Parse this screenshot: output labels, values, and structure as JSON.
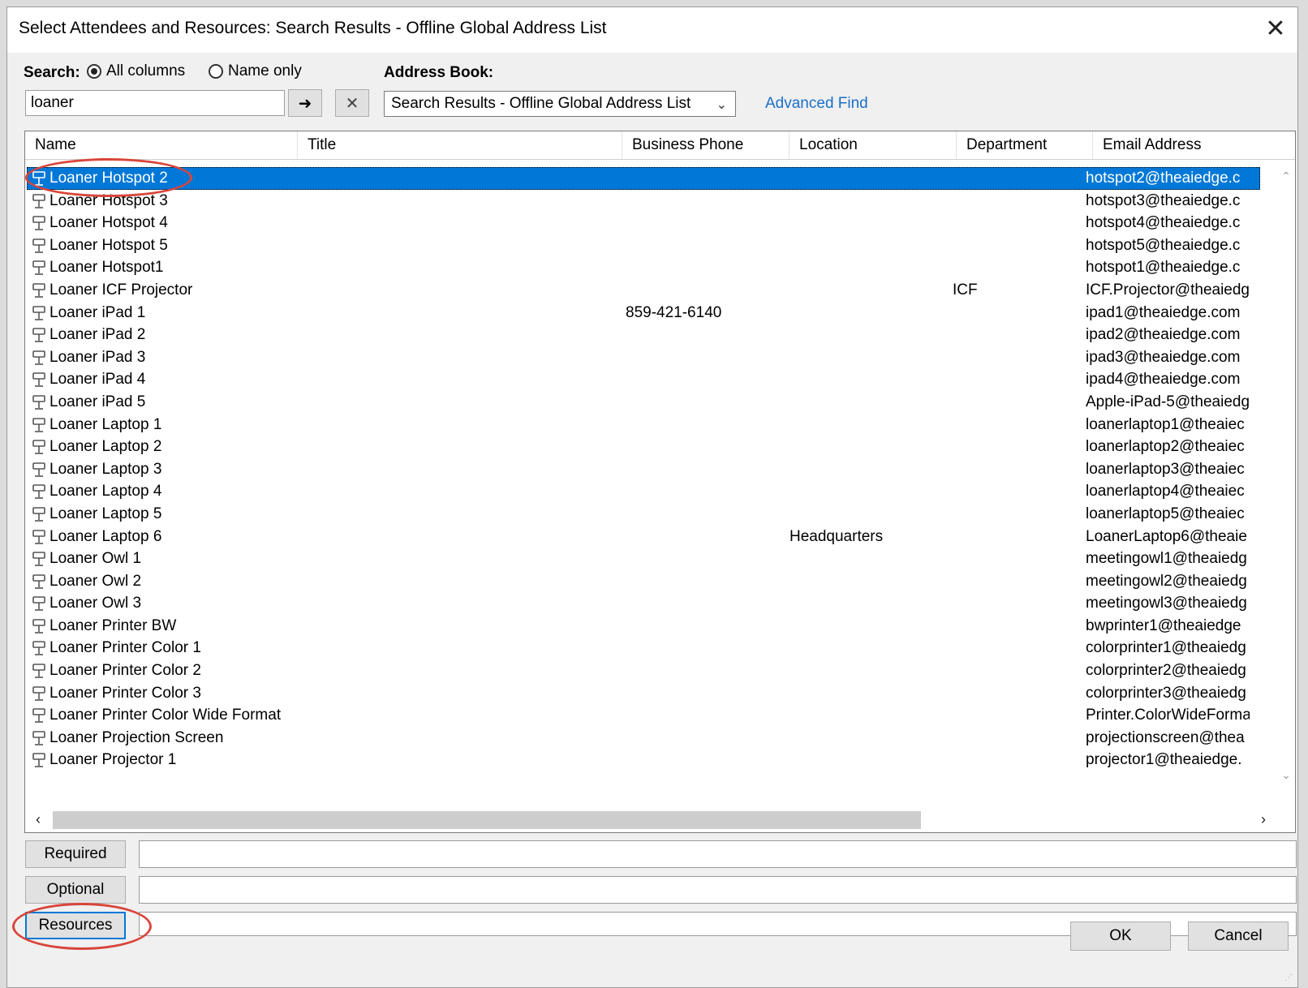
{
  "window": {
    "title": "Select Attendees and Resources: Search Results - Offline Global Address List"
  },
  "search": {
    "label": "Search:",
    "options": [
      "All columns",
      "Name only"
    ],
    "selected_option": "All columns",
    "value": "loaner",
    "go_symbol": "➜",
    "clear_symbol": "✕"
  },
  "address_book": {
    "label": "Address Book:",
    "selected": "Search Results - Offline Global Address List"
  },
  "advanced_find": "Advanced Find",
  "columns": [
    "Name",
    "Title",
    "Business Phone",
    "Location",
    "Department",
    "Email Address"
  ],
  "rows": [
    {
      "name": "Loaner Hotspot 2",
      "phone": "",
      "location": "",
      "department": "",
      "email": "hotspot2@theaiedge.c",
      "selected": true
    },
    {
      "name": "Loaner Hotspot 3",
      "phone": "",
      "location": "",
      "department": "",
      "email": "hotspot3@theaiedge.c"
    },
    {
      "name": "Loaner Hotspot 4",
      "phone": "",
      "location": "",
      "department": "",
      "email": "hotspot4@theaiedge.c"
    },
    {
      "name": "Loaner Hotspot 5",
      "phone": "",
      "location": "",
      "department": "",
      "email": "hotspot5@theaiedge.c"
    },
    {
      "name": "Loaner Hotspot1",
      "phone": "",
      "location": "",
      "department": "",
      "email": "hotspot1@theaiedge.c"
    },
    {
      "name": "Loaner ICF Projector",
      "phone": "",
      "location": "",
      "department": "ICF",
      "email": "ICF.Projector@theaiedg"
    },
    {
      "name": "Loaner iPad 1",
      "phone": "859-421-6140",
      "location": "",
      "department": "",
      "email": "ipad1@theaiedge.com"
    },
    {
      "name": "Loaner iPad 2",
      "phone": "",
      "location": "",
      "department": "",
      "email": "ipad2@theaiedge.com"
    },
    {
      "name": "Loaner iPad 3",
      "phone": "",
      "location": "",
      "department": "",
      "email": "ipad3@theaiedge.com"
    },
    {
      "name": "Loaner iPad 4",
      "phone": "",
      "location": "",
      "department": "",
      "email": "ipad4@theaiedge.com"
    },
    {
      "name": "Loaner iPad 5",
      "phone": "",
      "location": "",
      "department": "",
      "email": "Apple-iPad-5@theaiedg"
    },
    {
      "name": "Loaner Laptop 1",
      "phone": "",
      "location": "",
      "department": "",
      "email": "loanerlaptop1@theaiec"
    },
    {
      "name": "Loaner Laptop 2",
      "phone": "",
      "location": "",
      "department": "",
      "email": "loanerlaptop2@theaiec"
    },
    {
      "name": "Loaner Laptop 3",
      "phone": "",
      "location": "",
      "department": "",
      "email": "loanerlaptop3@theaiec"
    },
    {
      "name": "Loaner Laptop 4",
      "phone": "",
      "location": "",
      "department": "",
      "email": "loanerlaptop4@theaiec"
    },
    {
      "name": "Loaner Laptop 5",
      "phone": "",
      "location": "",
      "department": "",
      "email": "loanerlaptop5@theaiec"
    },
    {
      "name": "Loaner Laptop 6",
      "phone": "",
      "location": "Headquarters",
      "department": "",
      "email": "LoanerLaptop6@theaie"
    },
    {
      "name": "Loaner Owl 1",
      "phone": "",
      "location": "",
      "department": "",
      "email": "meetingowl1@theaiedg"
    },
    {
      "name": "Loaner Owl 2",
      "phone": "",
      "location": "",
      "department": "",
      "email": "meetingowl2@theaiedg"
    },
    {
      "name": "Loaner Owl 3",
      "phone": "",
      "location": "",
      "department": "",
      "email": "meetingowl3@theaiedg"
    },
    {
      "name": "Loaner Printer BW",
      "phone": "",
      "location": "",
      "department": "",
      "email": "bwprinter1@theaiedge"
    },
    {
      "name": "Loaner Printer Color 1",
      "phone": "",
      "location": "",
      "department": "",
      "email": "colorprinter1@theaiedg"
    },
    {
      "name": "Loaner Printer Color 2",
      "phone": "",
      "location": "",
      "department": "",
      "email": "colorprinter2@theaiedg"
    },
    {
      "name": "Loaner Printer Color 3",
      "phone": "",
      "location": "",
      "department": "",
      "email": "colorprinter3@theaiedg"
    },
    {
      "name": "Loaner Printer Color Wide Format",
      "phone": "",
      "location": "",
      "department": "",
      "email": "Printer.ColorWideForma"
    },
    {
      "name": "Loaner Projection Screen",
      "phone": "",
      "location": "",
      "department": "",
      "email": "projectionscreen@thea"
    },
    {
      "name": "Loaner Projector 1",
      "phone": "",
      "location": "",
      "department": "",
      "email": "projector1@theaiedge."
    }
  ],
  "recipient_buttons": {
    "required": "Required",
    "optional": "Optional",
    "resources": "Resources"
  },
  "footer": {
    "ok": "OK",
    "cancel": "Cancel"
  },
  "colors": {
    "selection": "#0078d7",
    "link": "#1a6fc8",
    "annotation": "#d9453a"
  }
}
